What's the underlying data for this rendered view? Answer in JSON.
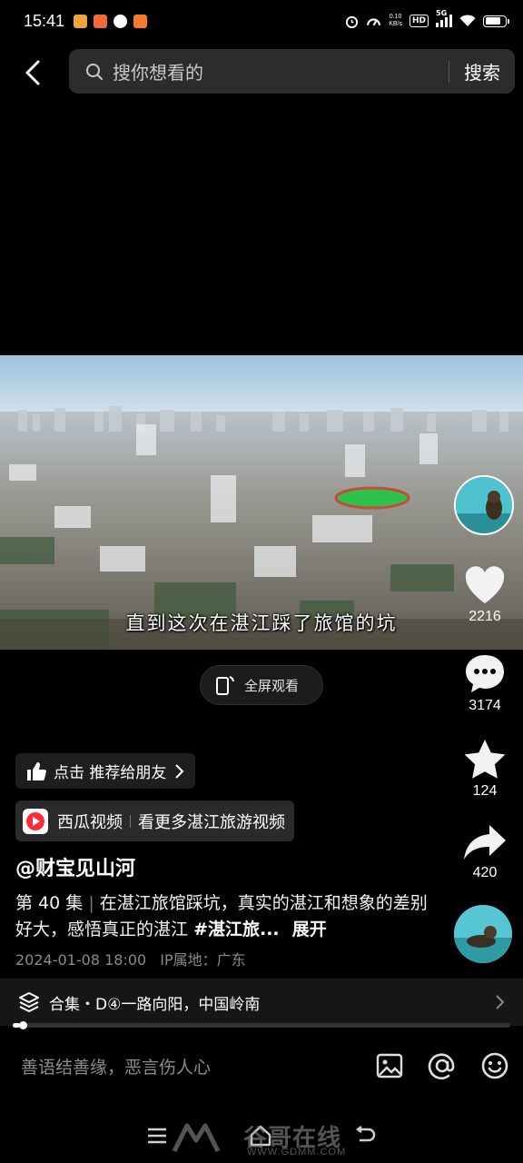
{
  "status_bar": {
    "time": "15:41",
    "net_speed_value": "0.10",
    "net_speed_unit": "KB/s",
    "hd_label": "HD",
    "signal_label": "5G",
    "battery_level": 0.8
  },
  "search": {
    "placeholder": "搜你想看的",
    "button_label": "搜索"
  },
  "video": {
    "subtitle": "直到这次在湛江踩了旅馆的坑",
    "fullscreen_label": "全屏观看"
  },
  "actions": {
    "likes": "2216",
    "comments": "3174",
    "favorites": "124",
    "shares": "420"
  },
  "recommend": {
    "label": "点击 推荐给朋友"
  },
  "xigua": {
    "app_name": "西瓜视频",
    "link_text": "看更多湛江旅游视频"
  },
  "post": {
    "author": "@财宝见山河",
    "episode": "第 40 集",
    "description": "在湛江旅馆踩坑，真实的湛江和想象的差别好大，感悟真正的湛江",
    "hashtag": "#湛江旅...",
    "expand_label": "展开",
    "date": "2024-01-08 18:00",
    "ip_location": "IP属地：广东"
  },
  "collection": {
    "label": "合集・D④一路向阳，中国岭南"
  },
  "playback": {
    "progress": 0.015
  },
  "comment_bar": {
    "placeholder": "善语结善缘，恶言伤人心"
  },
  "watermark": {
    "text": "谷哥在线",
    "url": "WWW.GDMM.COM"
  },
  "colors": {
    "background": "#000000",
    "search_bg": "#2c2c2e",
    "xigua_red": "#fe2c3b",
    "panel": "#161616"
  },
  "icons": [
    "back-icon",
    "search-icon",
    "like-icon",
    "comment-icon",
    "favorite-icon",
    "share-icon",
    "thumb-up-icon",
    "collection-icon",
    "image-icon",
    "at-icon",
    "emoji-icon",
    "menu-icon",
    "home-icon",
    "return-icon"
  ]
}
